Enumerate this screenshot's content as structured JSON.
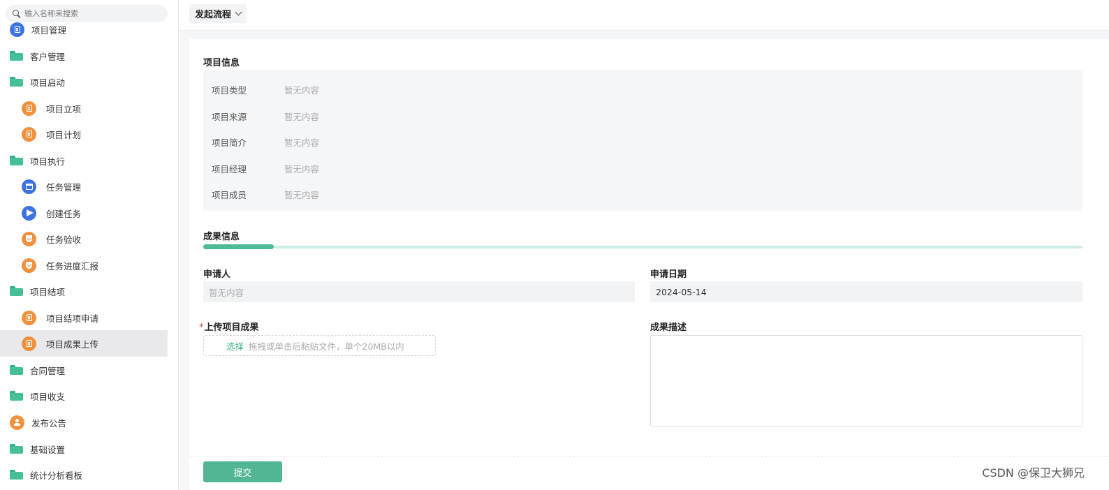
{
  "sidebar": {
    "search_placeholder": "输入名称来搜索",
    "items": [
      {
        "label": "项目管理",
        "icon": "blue-doc-icon"
      },
      {
        "label": "客户管理",
        "icon": "folder-icon"
      },
      {
        "label": "项目启动",
        "icon": "folder-icon"
      },
      {
        "label": "项目立项",
        "icon": "orange-doc-icon"
      },
      {
        "label": "项目计划",
        "icon": "orange-doc-icon"
      },
      {
        "label": "项目执行",
        "icon": "folder-icon"
      },
      {
        "label": "任务管理",
        "icon": "blue-calendar-icon"
      },
      {
        "label": "创建任务",
        "icon": "blue-send-icon"
      },
      {
        "label": "任务验收",
        "icon": "orange-shield-icon"
      },
      {
        "label": "任务进度汇报",
        "icon": "orange-shield-icon"
      },
      {
        "label": "项目结项",
        "icon": "folder-icon"
      },
      {
        "label": "项目结项申请",
        "icon": "orange-doc-icon"
      },
      {
        "label": "项目成果上传",
        "icon": "orange-doc-icon",
        "active": true
      },
      {
        "label": "合同管理",
        "icon": "folder-icon"
      },
      {
        "label": "项目收支",
        "icon": "folder-icon"
      },
      {
        "label": "发布公告",
        "icon": "orange-user-icon"
      },
      {
        "label": "基础设置",
        "icon": "folder-icon"
      },
      {
        "label": "统计分析看板",
        "icon": "folder-icon"
      }
    ]
  },
  "topbar": {
    "flow_button": "发起流程"
  },
  "project_info": {
    "title": "项目信息",
    "rows": [
      {
        "key": "项目类型",
        "value": "暂无内容"
      },
      {
        "key": "项目来源",
        "value": "暂无内容"
      },
      {
        "key": "项目简介",
        "value": "暂无内容"
      },
      {
        "key": "项目经理",
        "value": "暂无内容"
      },
      {
        "key": "项目成员",
        "value": "暂无内容"
      }
    ]
  },
  "result_info": {
    "title": "成果信息",
    "progress_fraction": 0.08,
    "applicant_label": "申请人",
    "applicant_value": "暂无内容",
    "date_label": "申请日期",
    "date_value": "2024-05-14",
    "upload_label": "上传项目成果",
    "upload_required_mark": "*",
    "upload_pick": "选择",
    "upload_hint": "拖拽或单击后粘贴文件，单个20MB以内",
    "desc_label": "成果描述",
    "desc_value": ""
  },
  "footer": {
    "submit_label": "提交"
  },
  "watermark": "CSDN @保卫大狮兄",
  "colors": {
    "accent": "#52b594",
    "folder": "#45bf99",
    "orange": "#f0913e",
    "blue": "#3b73e0"
  }
}
